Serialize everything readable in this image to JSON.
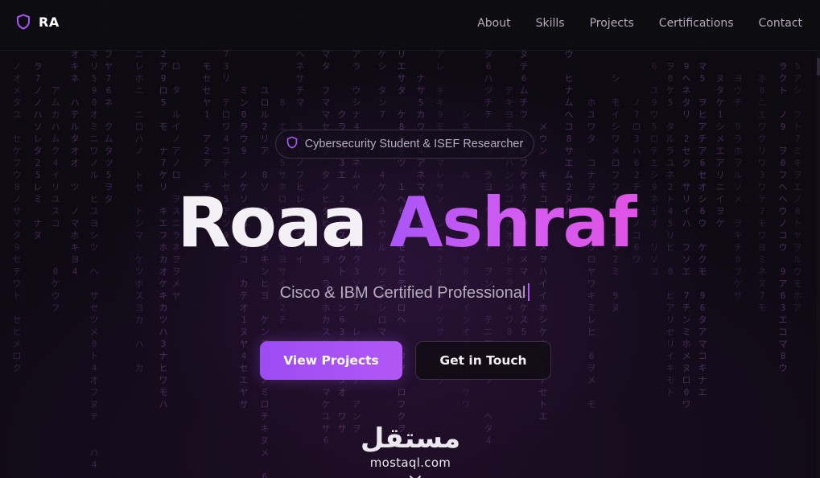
{
  "nav": {
    "logo_icon": "shield-icon",
    "brand": "RA",
    "links": [
      "About",
      "Skills",
      "Projects",
      "Certifications",
      "Contact"
    ]
  },
  "hero": {
    "badge_icon": "shield-icon",
    "badge": "Cybersecurity Student & ISEF Researcher",
    "title_first": "Roaa",
    "title_last": "Ashraf",
    "subtitle": "Cisco & IBM Certified Professional",
    "primary_button": "View Projects",
    "secondary_button": "Get in Touch",
    "scroll_icon": "chevron-down-icon"
  },
  "watermark": {
    "logo_text": "مستقل",
    "site": "mostaql.com"
  },
  "colors": {
    "accent": "#a855f7",
    "accent_pink": "#d946ef",
    "background": "#0d0a12",
    "matrix_glyphs": "#5e3a74"
  }
}
